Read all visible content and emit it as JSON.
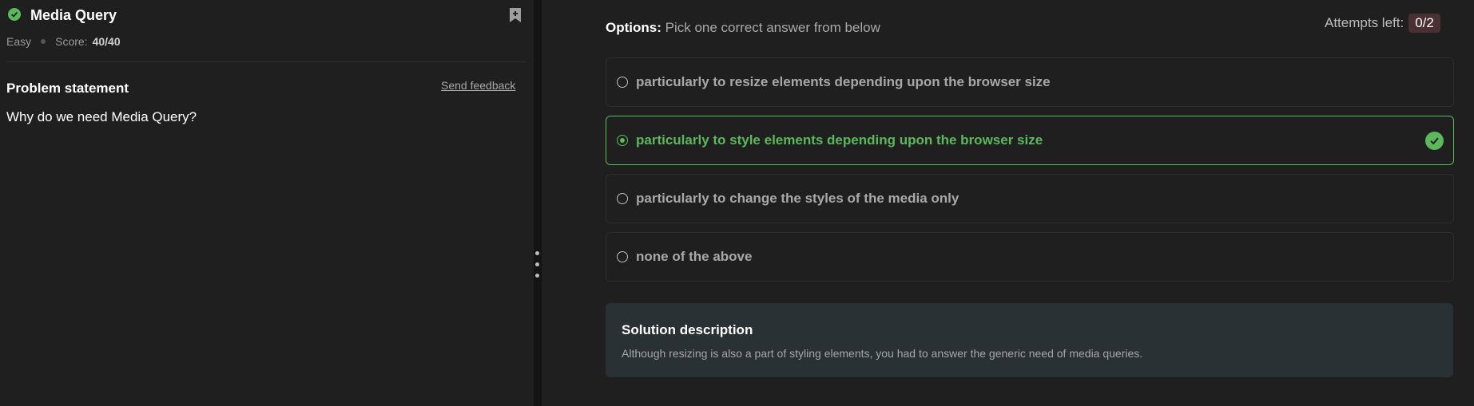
{
  "problem": {
    "title": "Media Query",
    "difficulty": "Easy",
    "score_label": "Score:",
    "score_value": "40/40",
    "statement_title": "Problem statement",
    "feedback_label": "Send feedback",
    "question": "Why do we need Media Query?",
    "status_icon": "check-circle-icon",
    "bookmark_icon": "bookmark-add-icon"
  },
  "options_panel": {
    "heading_bold": "Options:",
    "heading_text": "Pick one correct answer from below",
    "attempts_label": "Attempts left:",
    "attempts_value": "0/2",
    "options": [
      {
        "label": "particularly to resize elements depending upon the browser size",
        "selected": false,
        "correct": false
      },
      {
        "label": "particularly to style elements depending upon the browser size",
        "selected": true,
        "correct": true
      },
      {
        "label": "particularly to change the styles of the media only",
        "selected": false,
        "correct": false
      },
      {
        "label": "none of the above",
        "selected": false,
        "correct": false
      }
    ]
  },
  "solution": {
    "title": "Solution description",
    "text": "Although resizing is also a part of styling elements, you had to answer the generic need of media queries."
  },
  "colors": {
    "background": "#1f1f1f",
    "accent_green": "#5cb85c",
    "solution_bg": "#293134",
    "attempt_badge_bg": "#4a2f33"
  }
}
